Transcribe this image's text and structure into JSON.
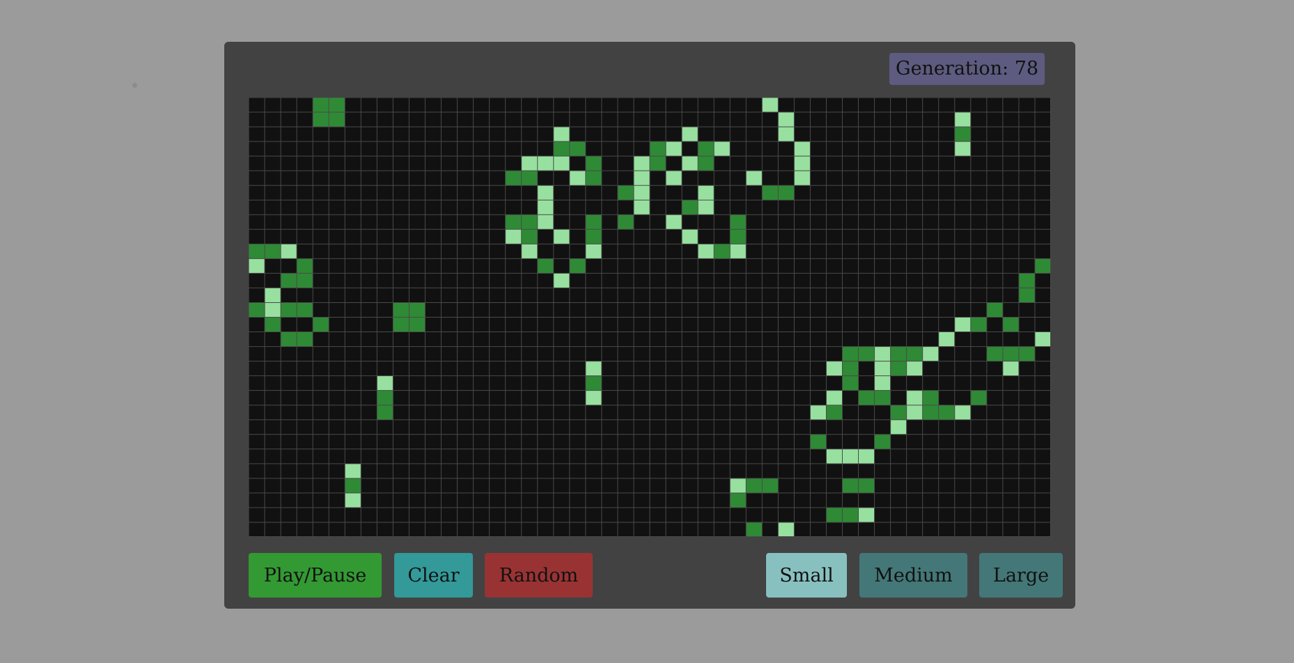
{
  "generation_label": "Generation: 78",
  "controls": {
    "play_pause": "Play/Pause",
    "clear": "Clear",
    "random": "Random",
    "small": "Small",
    "medium": "Medium",
    "large": "Large"
  },
  "colors": {
    "page_bg": "#9b9b9b",
    "panel_bg": "#424242",
    "grid_bg": "#111111",
    "grid_line": "#4a4a4a",
    "cell_new": "#98e09f",
    "cell_old": "#2f8a35",
    "generation_bg": "#5d5b7f",
    "play_pause_bg": "#339933",
    "clear_bg": "#339999",
    "random_bg": "#993333",
    "size_selected_bg": "#88c0c0",
    "size_bg": "#447777"
  },
  "grid": {
    "cols": 50,
    "rows": 30,
    "selected_size": "Small",
    "cells_new": [
      [
        32,
        0
      ],
      [
        33,
        1
      ],
      [
        44,
        1
      ],
      [
        19,
        2
      ],
      [
        27,
        2
      ],
      [
        33,
        2
      ],
      [
        44,
        3
      ],
      [
        26,
        3
      ],
      [
        29,
        3
      ],
      [
        34,
        3
      ],
      [
        17,
        4
      ],
      [
        18,
        4
      ],
      [
        19,
        4
      ],
      [
        24,
        4
      ],
      [
        27,
        4
      ],
      [
        34,
        4
      ],
      [
        20,
        5
      ],
      [
        24,
        5
      ],
      [
        26,
        5
      ],
      [
        31,
        5
      ],
      [
        34,
        5
      ],
      [
        18,
        6
      ],
      [
        24,
        6
      ],
      [
        28,
        6
      ],
      [
        18,
        7
      ],
      [
        24,
        7
      ],
      [
        28,
        7
      ],
      [
        18,
        8
      ],
      [
        26,
        8
      ],
      [
        16,
        9
      ],
      [
        19,
        9
      ],
      [
        27,
        9
      ],
      [
        2,
        10
      ],
      [
        17,
        10
      ],
      [
        21,
        10
      ],
      [
        28,
        10
      ],
      [
        30,
        10
      ],
      [
        0,
        11
      ],
      [
        19,
        12
      ],
      [
        1,
        13
      ],
      [
        1,
        14
      ],
      [
        44,
        15
      ],
      [
        43,
        16
      ],
      [
        49,
        16
      ],
      [
        39,
        17
      ],
      [
        42,
        17
      ],
      [
        21,
        18
      ],
      [
        36,
        18
      ],
      [
        39,
        18
      ],
      [
        41,
        18
      ],
      [
        47,
        18
      ],
      [
        8,
        19
      ],
      [
        39,
        19
      ],
      [
        21,
        20
      ],
      [
        36,
        20
      ],
      [
        41,
        20
      ],
      [
        35,
        21
      ],
      [
        41,
        21
      ],
      [
        44,
        21
      ],
      [
        40,
        22
      ],
      [
        36,
        24
      ],
      [
        37,
        24
      ],
      [
        38,
        24
      ],
      [
        6,
        25
      ],
      [
        30,
        26
      ],
      [
        6,
        27
      ],
      [
        38,
        28
      ],
      [
        33,
        29
      ]
    ],
    "cells_old": [
      [
        4,
        0
      ],
      [
        5,
        0
      ],
      [
        4,
        1
      ],
      [
        5,
        1
      ],
      [
        44,
        2
      ],
      [
        19,
        3
      ],
      [
        20,
        3
      ],
      [
        25,
        3
      ],
      [
        28,
        3
      ],
      [
        21,
        4
      ],
      [
        25,
        4
      ],
      [
        28,
        4
      ],
      [
        16,
        5
      ],
      [
        17,
        5
      ],
      [
        21,
        5
      ],
      [
        23,
        6
      ],
      [
        32,
        6
      ],
      [
        33,
        6
      ],
      [
        27,
        7
      ],
      [
        16,
        8
      ],
      [
        17,
        8
      ],
      [
        21,
        8
      ],
      [
        23,
        8
      ],
      [
        30,
        8
      ],
      [
        17,
        9
      ],
      [
        21,
        9
      ],
      [
        30,
        9
      ],
      [
        0,
        10
      ],
      [
        1,
        10
      ],
      [
        29,
        10
      ],
      [
        3,
        11
      ],
      [
        18,
        11
      ],
      [
        20,
        11
      ],
      [
        49,
        11
      ],
      [
        2,
        12
      ],
      [
        3,
        12
      ],
      [
        48,
        12
      ],
      [
        48,
        13
      ],
      [
        0,
        14
      ],
      [
        2,
        14
      ],
      [
        3,
        14
      ],
      [
        9,
        14
      ],
      [
        10,
        14
      ],
      [
        46,
        14
      ],
      [
        1,
        15
      ],
      [
        4,
        15
      ],
      [
        9,
        15
      ],
      [
        10,
        15
      ],
      [
        45,
        15
      ],
      [
        47,
        15
      ],
      [
        2,
        16
      ],
      [
        3,
        16
      ],
      [
        37,
        17
      ],
      [
        38,
        17
      ],
      [
        40,
        17
      ],
      [
        41,
        17
      ],
      [
        46,
        17
      ],
      [
        47,
        17
      ],
      [
        48,
        17
      ],
      [
        37,
        18
      ],
      [
        40,
        18
      ],
      [
        21,
        19
      ],
      [
        37,
        19
      ],
      [
        8,
        20
      ],
      [
        38,
        20
      ],
      [
        39,
        20
      ],
      [
        42,
        20
      ],
      [
        45,
        20
      ],
      [
        8,
        21
      ],
      [
        36,
        21
      ],
      [
        40,
        21
      ],
      [
        42,
        21
      ],
      [
        43,
        21
      ],
      [
        35,
        23
      ],
      [
        39,
        23
      ],
      [
        6,
        26
      ],
      [
        31,
        26
      ],
      [
        32,
        26
      ],
      [
        37,
        26
      ],
      [
        38,
        26
      ],
      [
        30,
        27
      ],
      [
        36,
        28
      ],
      [
        37,
        28
      ],
      [
        31,
        29
      ]
    ]
  }
}
